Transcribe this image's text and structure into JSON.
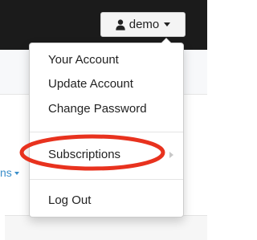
{
  "navbar": {
    "user_label": "demo",
    "user_icon": "user-icon",
    "caret_icon": "caret-down-icon"
  },
  "background": {
    "partial_link_text": "ns"
  },
  "dropdown": {
    "items": [
      {
        "label": "Your Account"
      },
      {
        "label": "Update Account"
      },
      {
        "label": "Change Password"
      },
      {
        "label": "Subscriptions",
        "has_submenu": true
      },
      {
        "label": "Log Out"
      }
    ]
  },
  "colors": {
    "navbar_bg": "#1b1b1b",
    "annotation_red": "#e8321e",
    "link_blue": "#3a8ec9"
  }
}
